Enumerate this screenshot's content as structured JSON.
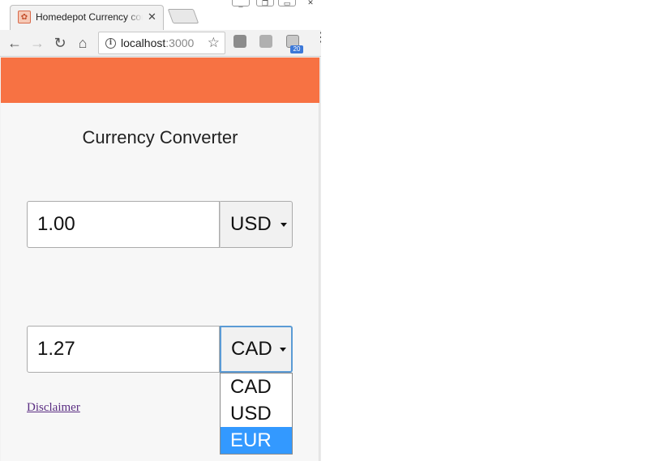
{
  "browser": {
    "tab_title": "Homedepot Currency converter",
    "tab_close": "✕",
    "url_host": "localhost",
    "url_port": ":3000",
    "extension_badge": "20"
  },
  "page": {
    "title": "Currency Converter",
    "header_color": "#f77243",
    "from": {
      "amount": "1.00",
      "currency": "USD"
    },
    "to": {
      "amount": "1.27",
      "currency": "CAD"
    },
    "dropdown_options": [
      "CAD",
      "USD",
      "EUR"
    ],
    "dropdown_highlighted": "EUR",
    "disclaimer_label": "Disclaimer"
  }
}
